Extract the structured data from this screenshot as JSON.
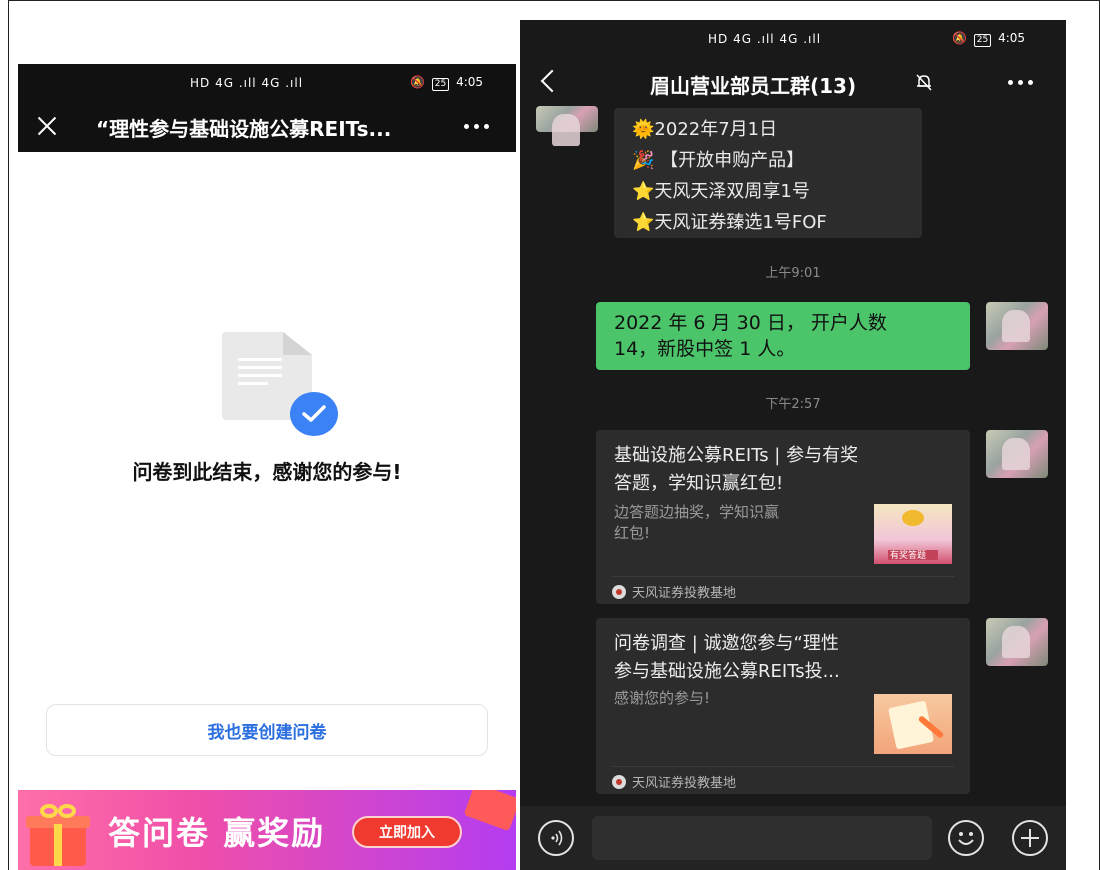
{
  "left_phone": {
    "status": {
      "network": "HD 4G .ıll 4G .ıll",
      "battery": "25",
      "time": "4:05"
    },
    "nav": {
      "title": "“理性参与基础设施公募REITs..."
    },
    "end_message": "问卷到此结束，感谢您的参与!",
    "create_button": "我也要创建问卷",
    "banner": {
      "text": "答问卷 赢奖励",
      "join_button": "立即加入"
    }
  },
  "right_phone": {
    "status": {
      "network": "HD 4G .ıll 4G .ıll",
      "battery": "25",
      "time": "4:05"
    },
    "nav": {
      "title": "眉山营业部员工群(13)"
    },
    "messages": {
      "m1_lines": [
        "🌞2022年7月1日",
        "🎉 【开放申购产品】",
        "⭐天风天泽双周享1号",
        "⭐天风证券臻选1号FOF"
      ],
      "ts1": "上午9:01",
      "m2_lines": [
        "2022 年 6 月 30 日， 开户人数",
        "14，新股中签 1 人。"
      ],
      "ts2": "下午2:57",
      "card1": {
        "title_lines": [
          "基础设施公募REITs | 参与有奖",
          "答题，学知识赢红包!"
        ],
        "sub_lines": [
          "边答题边抽奖，学知识赢",
          "红包!"
        ],
        "thumb_text": "有奖答题",
        "source": "天风证券投教基地"
      },
      "card2": {
        "title_lines": [
          "问卷调查 | 诚邀您参与“理性",
          "参与基础设施公募REITs投..."
        ],
        "sub": "感谢您的参与!",
        "source": "天风证券投教基地"
      }
    }
  },
  "colors": {
    "green_bubble": "#4bc46a",
    "dark_bg": "#191919",
    "link_blue": "#2b6fe0"
  }
}
